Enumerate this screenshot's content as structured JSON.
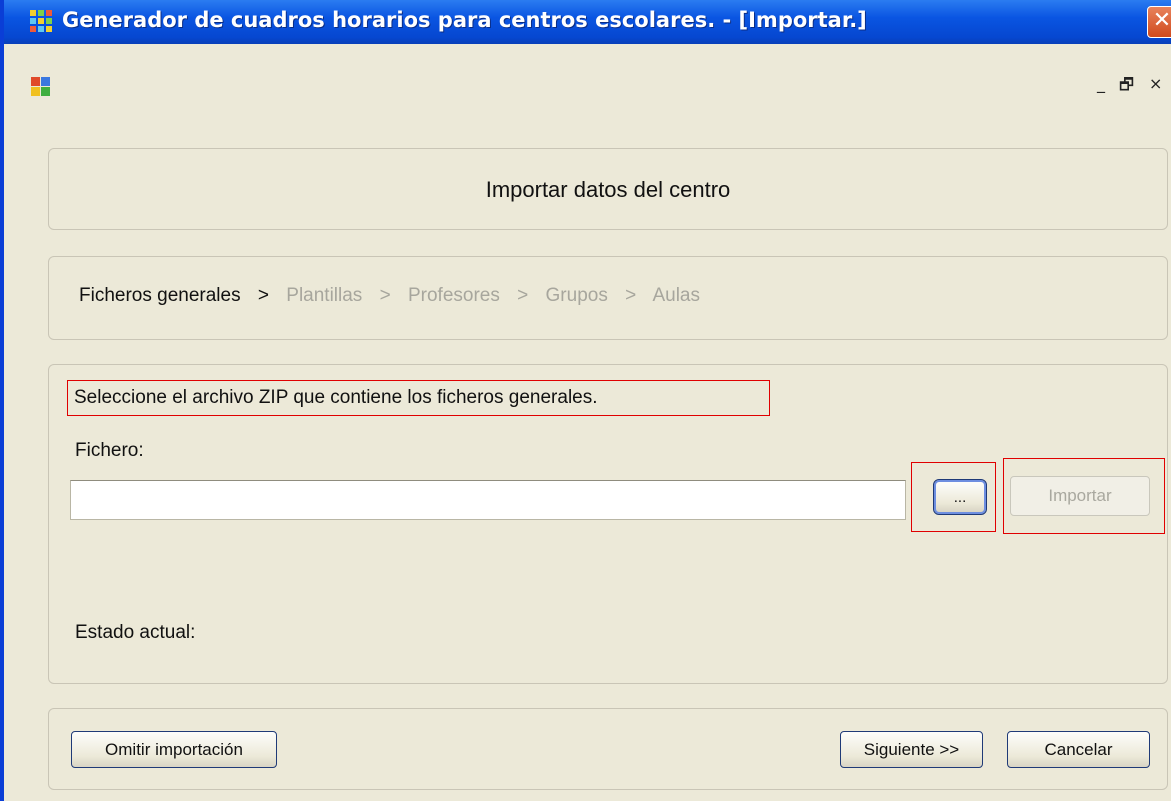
{
  "window": {
    "title": "Generador de cuadros horarios para centros escolares. - [Importar.]",
    "close_glyph": "✕"
  },
  "mdi": {
    "minimize_glyph": "_",
    "restore_glyph": "🗗",
    "close_glyph": "×"
  },
  "header": {
    "title": "Importar datos del centro"
  },
  "steps": {
    "items": [
      {
        "label": "Ficheros generales",
        "active": true
      },
      {
        "label": "Plantillas",
        "active": false
      },
      {
        "label": "Profesores",
        "active": false
      },
      {
        "label": "Grupos",
        "active": false
      },
      {
        "label": "Aulas",
        "active": false
      }
    ],
    "separator": ">"
  },
  "import_panel": {
    "instruction": "Seleccione el archivo ZIP que contiene los ficheros generales.",
    "file_label": "Fichero:",
    "file_value": "",
    "browse_label": "...",
    "import_label": "Importar",
    "status_label": "Estado actual:"
  },
  "footer": {
    "omit_label": "Omitir importación",
    "next_label": "Siguiente >>",
    "cancel_label": "Cancelar"
  },
  "colors": {
    "titlebar": "#0a55e2",
    "window_bg": "#ece9d8",
    "highlight_box": "#e00000",
    "disabled_text": "#a9a89f"
  }
}
